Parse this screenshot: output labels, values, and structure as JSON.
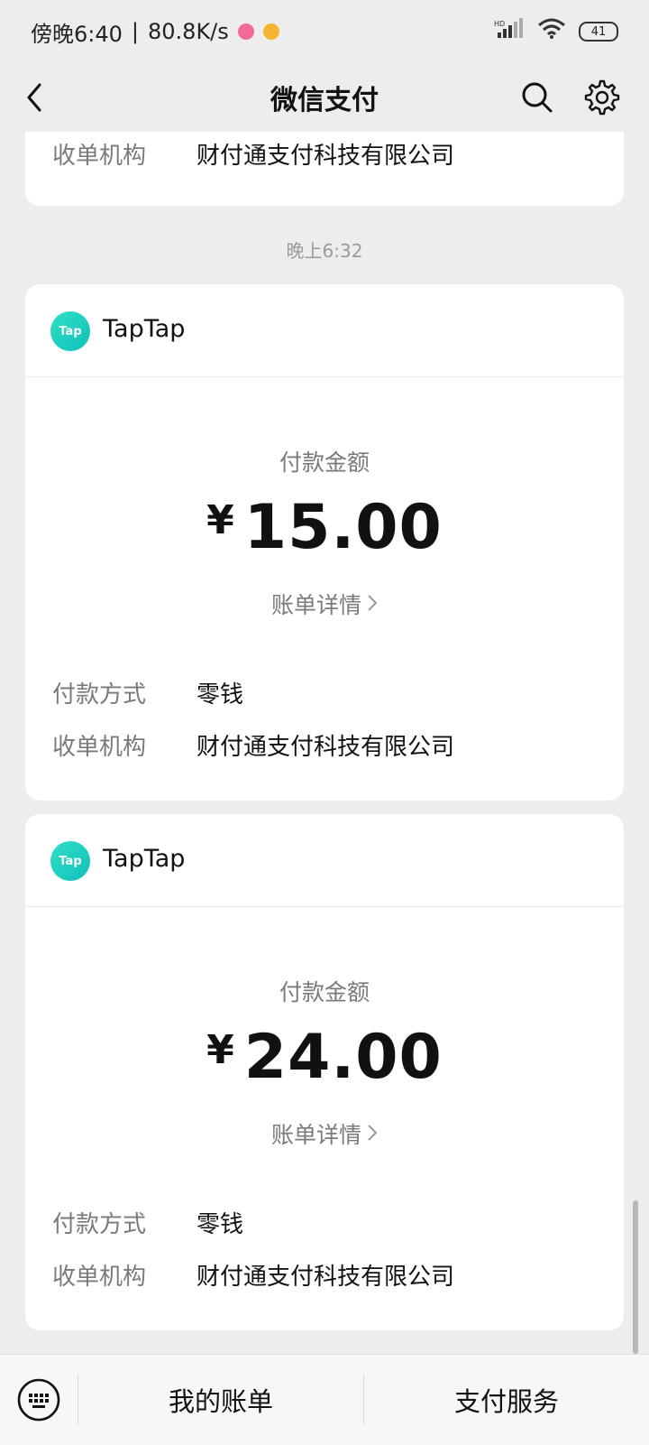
{
  "status_bar": {
    "time": "傍晚6:40",
    "speed": "80.8K/s",
    "battery": "41",
    "network": "HD"
  },
  "nav": {
    "title": "微信支付"
  },
  "top_card": {
    "merchant_label": "收单机构",
    "merchant_value": "财付通支付科技有限公司"
  },
  "time_separator": "晚上6:32",
  "cards": [
    {
      "merchant": "TapTap",
      "logo_text": "Tap",
      "amount_label": "付款金额",
      "currency": "¥",
      "amount": "15.00",
      "detail_link": "账单详情",
      "pay_method_label": "付款方式",
      "pay_method_value": "零钱",
      "acquirer_label": "收单机构",
      "acquirer_value": "财付通支付科技有限公司"
    },
    {
      "merchant": "TapTap",
      "logo_text": "Tap",
      "amount_label": "付款金额",
      "currency": "¥",
      "amount": "24.00",
      "detail_link": "账单详情",
      "pay_method_label": "付款方式",
      "pay_method_value": "零钱",
      "acquirer_label": "收单机构",
      "acquirer_value": "财付通支付科技有限公司"
    }
  ],
  "bottom_bar": {
    "my_bills": "我的账单",
    "pay_services": "支付服务"
  },
  "colors": {
    "background": "#ededed",
    "card": "#ffffff",
    "taptap_brand": "#18c9bd"
  }
}
